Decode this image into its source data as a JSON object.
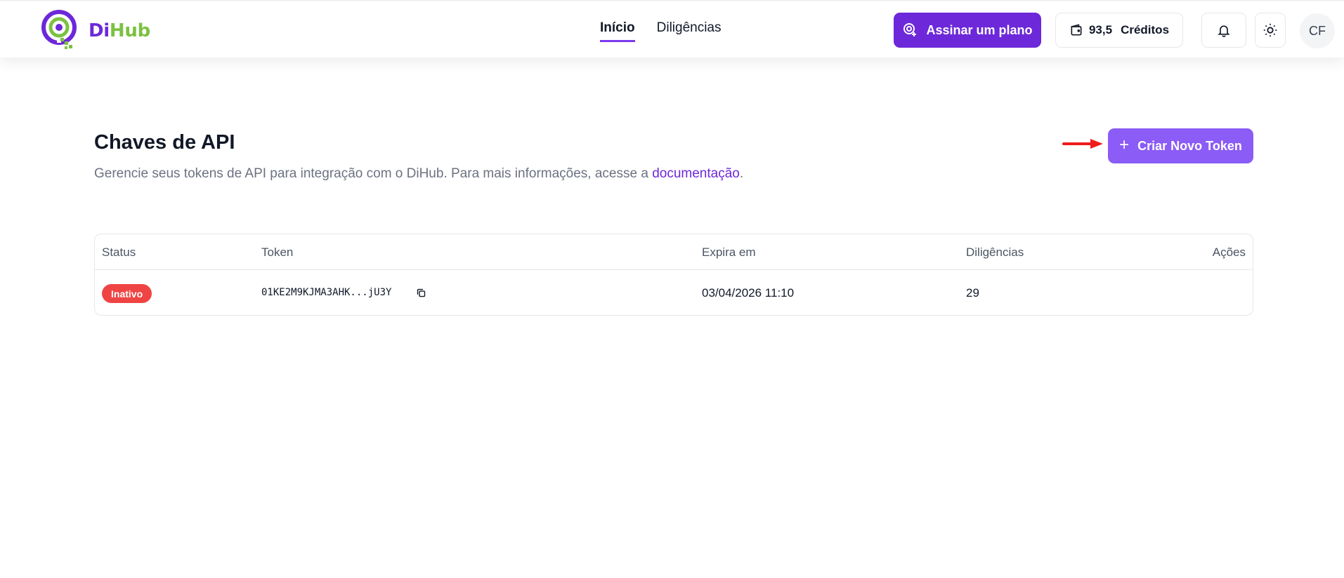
{
  "brand": {
    "di": "Di",
    "hub": "Hub",
    "primary_color": "#6d28d9",
    "secondary_color": "#7cc142"
  },
  "nav": {
    "items": [
      {
        "label": "Início",
        "active": true
      },
      {
        "label": "Diligências",
        "active": false
      }
    ]
  },
  "header": {
    "plan_button": "Assinar um plano",
    "credits_value": "93,5",
    "credits_label": "Créditos",
    "bell_icon": "bell-icon",
    "theme_icon": "sun-icon",
    "avatar_initials": "CF"
  },
  "page": {
    "title": "Chaves de API",
    "description_prefix": "Gerencie seus tokens de API para integração com o DiHub. Para mais informações, acesse a ",
    "description_link": "documentação",
    "description_suffix": ".",
    "new_token_button": "Criar Novo Token",
    "new_token_icon": "plus-icon"
  },
  "table": {
    "headers": {
      "status": "Status",
      "token": "Token",
      "expires": "Expira em",
      "diligences": "Diligências",
      "actions": "Ações"
    },
    "rows": [
      {
        "status": "Inativo",
        "status_color": "#ef4444",
        "token": "01KE2M9KJMA3AHK...jU3Y",
        "expires": "03/04/2026 11:10",
        "diligences": "29"
      }
    ]
  }
}
